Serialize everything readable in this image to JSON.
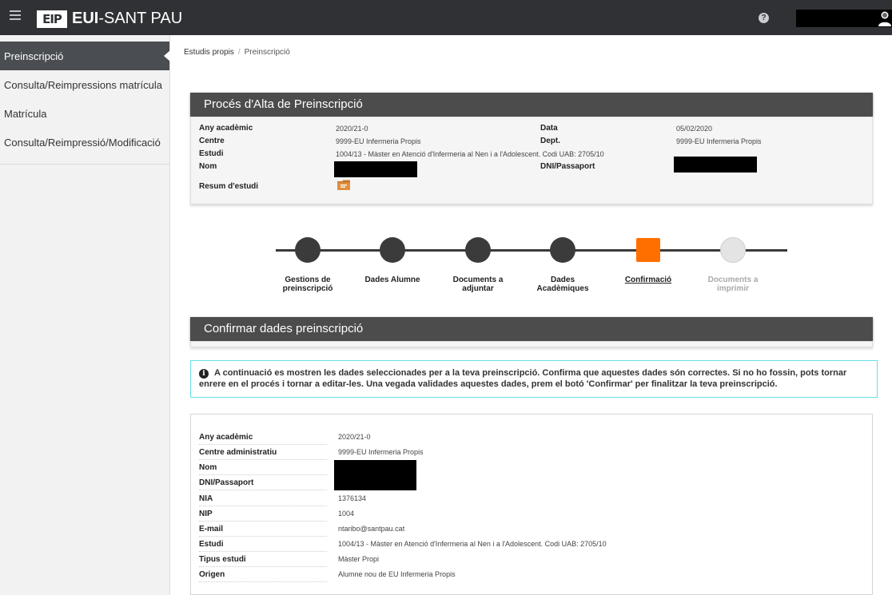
{
  "header": {
    "logo_mark": "EIP",
    "logo_text_bold": "EUI",
    "logo_text_rest": "-SANT PAU",
    "help_icon": "?"
  },
  "sidebar": {
    "items": [
      {
        "label": "Preinscripció",
        "active": true
      },
      {
        "label": "Consulta/Reimpressions matrícula",
        "active": false
      },
      {
        "label": "Matrícula",
        "active": false
      },
      {
        "label": "Consulta/Reimpressió/Modificació",
        "active": false
      }
    ]
  },
  "breadcrumb": {
    "root": "Estudis propis",
    "separator": "/",
    "current": "Preinscripció"
  },
  "process_panel": {
    "title": "Procés d'Alta de Preinscripció",
    "any_academic_label": "Any acadèmic",
    "any_academic_value": "2020/21-0",
    "data_label": "Data",
    "data_value": "05/02/2020",
    "centre_label": "Centre",
    "centre_value": "9999-EU Infermeria Propis",
    "dept_label": "Dept.",
    "dept_value": "9999-EU Infermeria Propis",
    "estudi_label": "Estudi",
    "estudi_value": "1004/13 - Màster en Atenció d'Infermeria al Nen i a l'Adolescent. Codi UAB: 2705/10",
    "nom_label": "Nom",
    "dni_label": "DNI/Passaport",
    "resum_label": "Resum d'estudi"
  },
  "steps": [
    {
      "line1": "Gestions de",
      "line2": "preinscripció",
      "state": "done"
    },
    {
      "line1": "Dades Alumne",
      "line2": "",
      "state": "done"
    },
    {
      "line1": "Documents a",
      "line2": "adjuntar",
      "state": "done"
    },
    {
      "line1": "Dades",
      "line2": "Acadèmiques",
      "state": "done"
    },
    {
      "line1": "Confirmació",
      "line2": "",
      "state": "current"
    },
    {
      "line1": "Documents a",
      "line2": "imprimir",
      "state": "future"
    }
  ],
  "confirm_panel": {
    "title": "Confirmar dades preinscripció"
  },
  "alert": {
    "text": "A continuació es mostren les dades seleccionades per a la teva preinscripció. Confirma que aquestes dades són correctes. Si no ho fossin, pots tornar enrere en el procés i tornar a editar-les. Una vegada validades aquestes dades, prem el botó 'Confirmar' per finalitzar la teva preinscripció."
  },
  "details": [
    {
      "label": "Any acadèmic",
      "value": "2020/21-0"
    },
    {
      "label": "Centre administratiu",
      "value": "9999-EU Infermeria Propis"
    },
    {
      "label": "Nom",
      "value": null
    },
    {
      "label": "DNI/Passaport",
      "value": null
    },
    {
      "label": "NIA",
      "value": "1376134"
    },
    {
      "label": "NIP",
      "value": "1004"
    },
    {
      "label": "E-mail",
      "value": "ntaribo@santpau.cat"
    },
    {
      "label": "Estudi",
      "value": "1004/13 - Màster en Atenció d'Infermeria al Nen i a l'Adolescent. Codi UAB: 2705/10"
    },
    {
      "label": "Tipus estudi",
      "value": "Màster Propi"
    },
    {
      "label": "Origen",
      "value": "Alumne nou de EU Infermeria Propis"
    }
  ],
  "colors": {
    "topbar": "#2f3135",
    "sidebar_active": "#4a4d52",
    "step_current": "#ff6f00",
    "alert_border": "#66e0e6"
  }
}
